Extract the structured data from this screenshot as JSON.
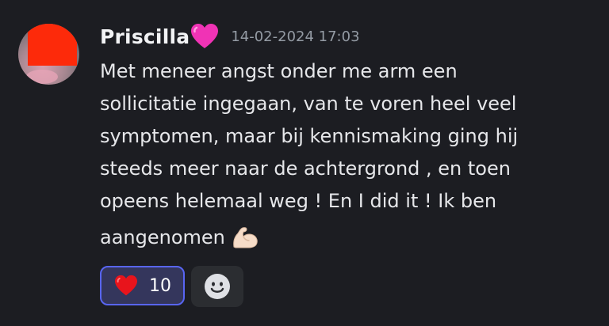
{
  "message": {
    "author": "Priscilla",
    "author_emoji": "pink-heart-icon",
    "timestamp": "14-02-2024 17:03",
    "content_lines": [
      "Met meneer angst onder me arm een",
      "sollicitatie ingegaan, van te voren heel veel",
      "symptomen, maar bij kennismaking ging hij",
      "steeds meer naar de achtergrond , en toen",
      "opeens helemaal weg ! En I did it ! Ik ben",
      "aangenomen"
    ],
    "trailing_emoji": "flexed-biceps-icon"
  },
  "reactions": [
    {
      "emoji": "red-heart-icon",
      "count": "10",
      "active": true
    }
  ],
  "add_reaction": {
    "icon": "smiley-face-icon"
  },
  "colors": {
    "background": "#1c1d22",
    "accent": "#5865f2",
    "active_reaction_bg": "#34365c",
    "redaction": "#fd2a0a"
  }
}
